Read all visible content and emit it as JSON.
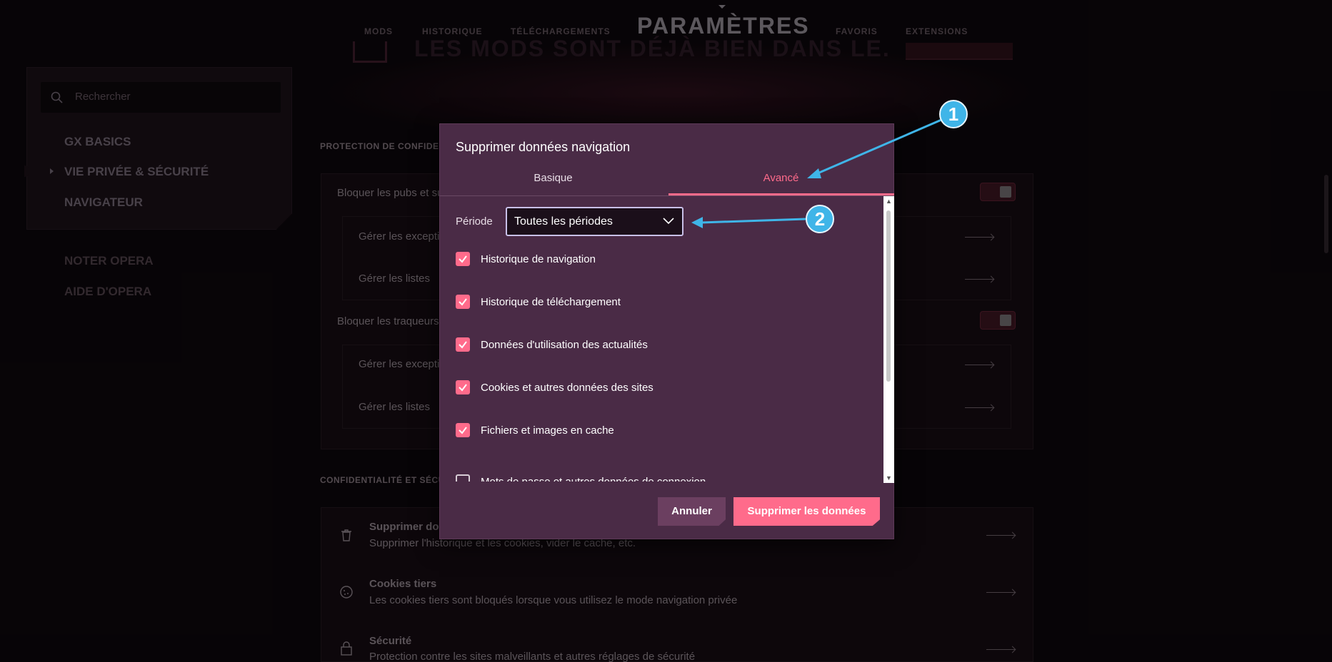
{
  "topnav": {
    "items": [
      "MODS",
      "HISTORIQUE",
      "TÉLÉCHARGEMENTS",
      "FAVORIS",
      "EXTENSIONS"
    ],
    "title": "PARAMÈTRES",
    "banner": "LES MODS SONT DÉJÀ BIEN DANS LE."
  },
  "sidebar": {
    "search_placeholder": "Rechercher",
    "items": [
      "GX BASICS",
      "VIE PRIVÉE & SÉCURITÉ",
      "NAVIGATEUR"
    ],
    "links": [
      "NOTER OPERA",
      "AIDE D'OPERA"
    ]
  },
  "content": {
    "section1_title": "PROTECTION DE CONFIDENTIALITÉ",
    "block_ads": "Bloquer les pubs et surfer deux fois plus vite",
    "manage_exceptions": "Gérer les exceptions",
    "manage_lists": "Gérer les listes",
    "block_trackers": "Bloquer les traqueurs",
    "section2_title": "CONFIDENTIALITÉ ET SÉCURITÉ",
    "rows": [
      {
        "title": "Supprimer données de navigation",
        "sub": "Supprimer l'historique et les cookies, vider le cache, etc."
      },
      {
        "title": "Cookies tiers",
        "sub": "Les cookies tiers sont bloqués lorsque vous utilisez le mode navigation privée"
      },
      {
        "title": "Sécurité",
        "sub": "Protection contre les sites malveillants et autres réglages de sécurité"
      }
    ]
  },
  "dialog": {
    "title": "Supprimer données navigation",
    "tabs": [
      "Basique",
      "Avancé"
    ],
    "active_tab": "Avancé",
    "period_label": "Période",
    "period_value": "Toutes les périodes",
    "checkboxes": [
      {
        "label": "Historique de navigation",
        "checked": true
      },
      {
        "label": "Historique de téléchargement",
        "checked": true
      },
      {
        "label": "Données d'utilisation des actualités",
        "checked": true
      },
      {
        "label": "Cookies et autres données des sites",
        "checked": true
      },
      {
        "label": "Fichiers et images en cache",
        "checked": true
      },
      {
        "label": "Mots de passe et autres données de connexion",
        "checked": false
      }
    ],
    "cancel": "Annuler",
    "delete": "Supprimer les données"
  },
  "annotations": {
    "badge1": "1",
    "badge2": "2"
  },
  "colors": {
    "accent": "#ff6b8b",
    "dialog_bg": "#4a2b46",
    "annotation": "#3fb5e8"
  }
}
